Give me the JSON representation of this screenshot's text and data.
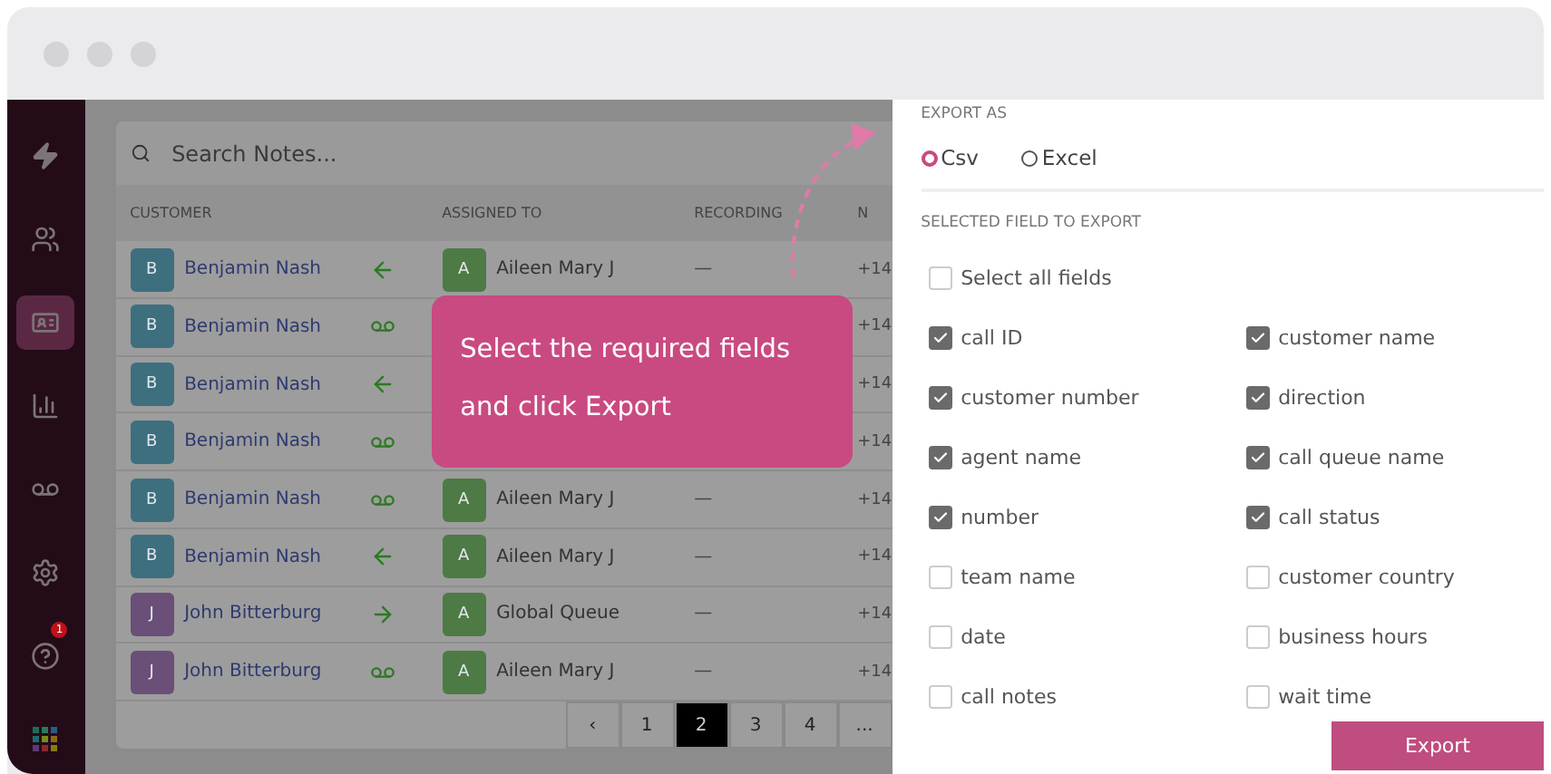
{
  "search": {
    "placeholder": "Search Notes..."
  },
  "table": {
    "columns": [
      "CUSTOMER",
      "ASSIGNED TO",
      "RECORDING",
      "N"
    ],
    "rows": [
      {
        "initial": "B",
        "customer": "Benjamin Nash",
        "color": "#3d6f7f",
        "kind": "in",
        "assignee_initial": "A",
        "assignee": "Aileen Mary J",
        "recording": "—",
        "number": "+14"
      },
      {
        "initial": "B",
        "customer": "Benjamin Nash",
        "color": "#3d6f7f",
        "kind": "voicemail",
        "number": "+14"
      },
      {
        "initial": "B",
        "customer": "Benjamin Nash",
        "color": "#3d6f7f",
        "kind": "in",
        "number": "+14"
      },
      {
        "initial": "B",
        "customer": "Benjamin Nash",
        "color": "#3d6f7f",
        "kind": "voicemail",
        "number": "+14"
      },
      {
        "initial": "B",
        "customer": "Benjamin Nash",
        "color": "#3d6f7f",
        "kind": "voicemail",
        "assignee_initial": "A",
        "assignee": "Aileen Mary J",
        "recording": "—",
        "number": "+14"
      },
      {
        "initial": "B",
        "customer": "Benjamin Nash",
        "color": "#3d6f7f",
        "kind": "in",
        "assignee_initial": "A",
        "assignee": "Aileen Mary J",
        "recording": "—",
        "number": "+14"
      },
      {
        "initial": "J",
        "customer": "John Bitterburg",
        "color": "#6a4f78",
        "kind": "out",
        "assignee_initial": "A",
        "assignee": "Global Queue",
        "recording": "—",
        "number": "+14"
      },
      {
        "initial": "J",
        "customer": "John Bitterburg",
        "color": "#6a4f78",
        "kind": "voicemail",
        "assignee_initial": "A",
        "assignee": "Aileen Mary J",
        "recording": "—",
        "number": "+14"
      }
    ]
  },
  "pagination": [
    {
      "label": "‹",
      "selected": false
    },
    {
      "label": "1",
      "selected": false
    },
    {
      "label": "2",
      "selected": true
    },
    {
      "label": "3",
      "selected": false
    },
    {
      "label": "4",
      "selected": false
    },
    {
      "label": "...",
      "selected": false
    }
  ],
  "sidebar": {
    "items": [
      {
        "kind": "bolt",
        "selected": false
      },
      {
        "kind": "users",
        "selected": false
      },
      {
        "kind": "card",
        "selected": true
      },
      {
        "kind": "chart",
        "selected": false
      },
      {
        "kind": "voicemail",
        "selected": false
      },
      {
        "kind": "gear",
        "selected": false
      },
      {
        "kind": "help",
        "selected": false,
        "badge": "1"
      },
      {
        "kind": "apps",
        "selected": false
      }
    ]
  },
  "tooltip": "Select the required fields and click Export",
  "export": {
    "export_as_label": "EXPORT AS",
    "formats": [
      {
        "label": "Csv",
        "selected": true
      },
      {
        "label": "Excel",
        "selected": false
      }
    ],
    "fields_label": "SELECTED FIELD TO EXPORT",
    "select_all": {
      "label": "Select all fields",
      "checked": false
    },
    "fields": [
      {
        "label": "call ID",
        "checked": true
      },
      {
        "label": "customer name",
        "checked": true
      },
      {
        "label": "customer number",
        "checked": true
      },
      {
        "label": "direction",
        "checked": true
      },
      {
        "label": "agent name",
        "checked": true
      },
      {
        "label": "call queue name",
        "checked": true
      },
      {
        "label": "number",
        "checked": true
      },
      {
        "label": "call status",
        "checked": true
      },
      {
        "label": "team name",
        "checked": false
      },
      {
        "label": "customer country",
        "checked": false
      },
      {
        "label": "date",
        "checked": false
      },
      {
        "label": "business hours",
        "checked": false
      },
      {
        "label": "call notes",
        "checked": false
      },
      {
        "label": "wait time",
        "checked": false
      }
    ],
    "button": "Export"
  }
}
